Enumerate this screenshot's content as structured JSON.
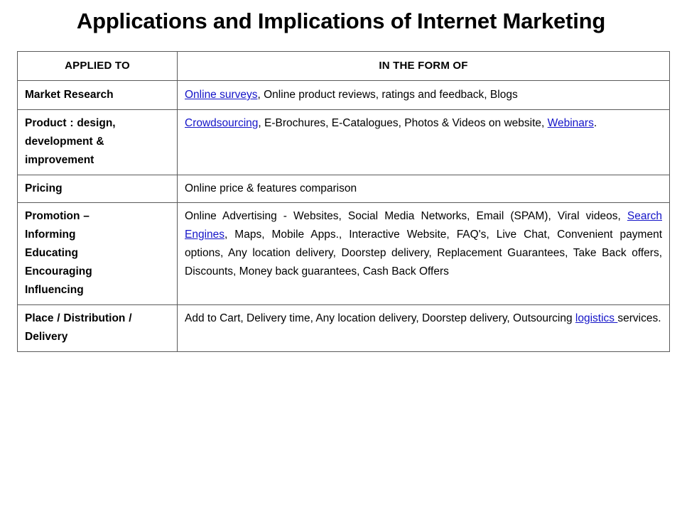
{
  "slide": {
    "title": "Applications and Implications of Internet Marketing",
    "link_color": "#1414c8",
    "text_color": "#000000",
    "background_color": "#ffffff",
    "border_color": "#5a5a5a"
  },
  "table": {
    "headers": {
      "applied_to": "APPLIED TO",
      "in_the_form_of": "IN THE FORM OF"
    },
    "rows": [
      {
        "applied_to": "Market Research",
        "form_of_parts": [
          {
            "text": "Online surveys",
            "link": true
          },
          {
            "text": ", Online product reviews, ratings and feedback, Blogs",
            "link": false
          }
        ],
        "form_of_plain": "Online surveys, Online product reviews, ratings and feedback, Blogs"
      },
      {
        "applied_to": "Product : design, development & improvement",
        "form_of_parts": [
          {
            "text": "Crowdsourcing",
            "link": true
          },
          {
            "text": ", E-Brochures, E-Catalogues, Photos & Videos on website, ",
            "link": false
          },
          {
            "text": "Webinars",
            "link": true
          },
          {
            "text": ".",
            "link": false
          }
        ],
        "form_of_plain": "Crowdsourcing, E-Brochures, E-Catalogues, Photos & Videos on website, Webinars."
      },
      {
        "applied_to": "Pricing",
        "form_of_parts": [
          {
            "text": "Online price & features comparison",
            "link": false
          }
        ],
        "form_of_plain": "Online price & features comparison"
      },
      {
        "applied_to": "Promotion – Informing Educating Encouraging Influencing",
        "form_of_parts": [
          {
            "text": "Online Advertising - Websites, Social Media Networks, Email (SPAM), Viral videos, ",
            "link": false
          },
          {
            "text": "Search Engines",
            "link": true
          },
          {
            "text": ", Maps, Mobile Apps., Interactive Website, FAQ's, Live Chat, Convenient payment options, Any location delivery, Doorstep delivery, Replacement Guarantees, Take Back offers, Discounts, Money back guarantees, Cash Back Offers",
            "link": false
          }
        ],
        "form_of_plain": "Online Advertising - Websites, Social Media Networks, Email (SPAM), Viral videos, Search Engines, Maps, Mobile Apps., Interactive Website, FAQ's, Live Chat, Convenient payment options, Any location delivery, Doorstep delivery, Replacement Guarantees, Take Back offers, Discounts, Money back guarantees, Cash Back Offers"
      },
      {
        "applied_to": "Place / Distribution / Delivery",
        "form_of_parts": [
          {
            "text": "Add to Cart, Delivery time, Any location delivery, Doorstep delivery, Outsourcing ",
            "link": false
          },
          {
            "text": "logistics ",
            "link": true
          },
          {
            "text": "services.",
            "link": false
          }
        ],
        "form_of_plain": "Add to Cart, Delivery time, Any location delivery, Doorstep delivery, Outsourcing logistics services."
      }
    ],
    "applied_to_lines": {
      "row_0": [
        "Market Research"
      ],
      "row_1": [
        "Product : design,",
        "development &",
        "improvement"
      ],
      "row_2": [
        "Pricing"
      ],
      "row_3": [
        "Promotion –",
        "Informing",
        "Educating",
        "Encouraging",
        "Influencing"
      ],
      "row_4": [
        "Place / Distribution /",
        "Delivery"
      ]
    }
  }
}
